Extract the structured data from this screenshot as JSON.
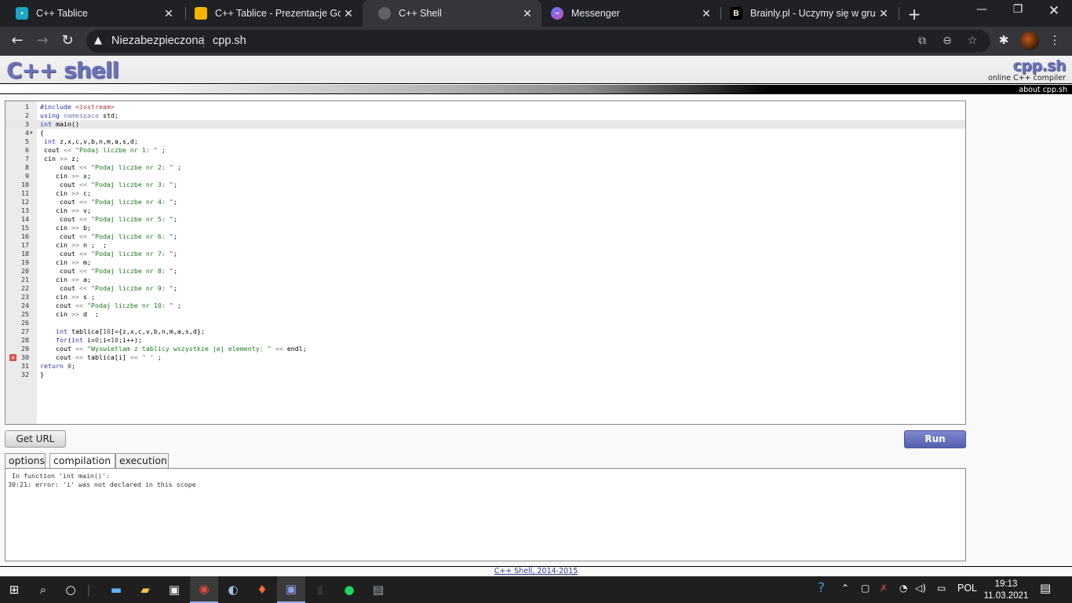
{
  "browser": {
    "tabs": [
      {
        "title": "C++ Tablice",
        "icon": "classroom-icon",
        "active": false
      },
      {
        "title": "C++ Tablice - Prezentacje Goo",
        "icon": "slides-icon",
        "active": false
      },
      {
        "title": "C++ Shell",
        "icon": "globe-icon",
        "active": true
      },
      {
        "title": "Messenger",
        "icon": "messenger-icon",
        "active": false
      },
      {
        "title": "Brainly.pl - Uczymy się w grupi",
        "icon": "brainly-icon",
        "active": false
      }
    ],
    "security_label": "Niezabezpieczona",
    "url": "cpp.sh"
  },
  "site": {
    "logo": "C++ shell",
    "logo_right": "cpp.sh",
    "tagline": "online C++ compiler",
    "about_link": "about cpp.sh",
    "footer_link": "C++ Shell, 2014-2015"
  },
  "editor": {
    "active_line": 3,
    "error_line": 30,
    "lines": [
      "#include <iostream>",
      "using namespace std;",
      "int main()",
      "{",
      " int z,x,c,v,b,n,m,a,s,d;",
      " cout << \"Podaj liczbe nr 1: \" ;",
      " cin >> z;",
      "     cout << \"Podaj liczbe nr 2: \" ;",
      "    cin >> x;",
      "     cout << \"Podaj liczbe nr 3: \";",
      "    cin >> c;",
      "     cout << \"Podaj liczbe nr 4: \";",
      "    cin >> v;",
      "     cout << \"Podaj liczbe nr 5: \";",
      "    cin >> b;",
      "     cout << \"Podaj liczbe nr 6: \";",
      "    cin >> n ;  ;",
      "     cout << \"Podaj liczbe nr 7: \";",
      "    cin >> m;",
      "     cout << \"Podaj liczbe nr 8: \";",
      "    cin >> a;",
      "     cout << \"Podaj liczbe nr 9: \";",
      "    cin >> s ;",
      "    cout << \"Podaj liczbe nr 10: \" ;",
      "    cin >> d  ;",
      "",
      "    int tablica[10]={z,x,c,v,b,n,m,a,s,d};",
      "    for(int i=0;i<10;i++);",
      "    cout << \"Wyswietlam z tablicy wszystkie jej elementy: \" << endl;",
      "    cout << tablica[i] << ' ' ;",
      "return 0;",
      "}"
    ]
  },
  "controls": {
    "get_url_label": "Get URL",
    "run_label": "Run",
    "tabs": [
      "options",
      "compilation",
      "execution"
    ],
    "active_tab": "compilation"
  },
  "output": {
    "text": " In function 'int main()':\n30:21: error: 'i' was not declared in this scope"
  },
  "taskbar": {
    "apps": [
      "start-icon",
      "search-icon",
      "cortana-icon",
      "desktop-icon",
      "file-explorer-icon",
      "store-icon",
      "chrome-icon",
      "steam-icon",
      "paint-icon",
      "discord-icon",
      "app-icon",
      "spotify-icon",
      "monitor-icon"
    ],
    "language": "POL",
    "time": "19:13",
    "date": "11.03.2021"
  }
}
